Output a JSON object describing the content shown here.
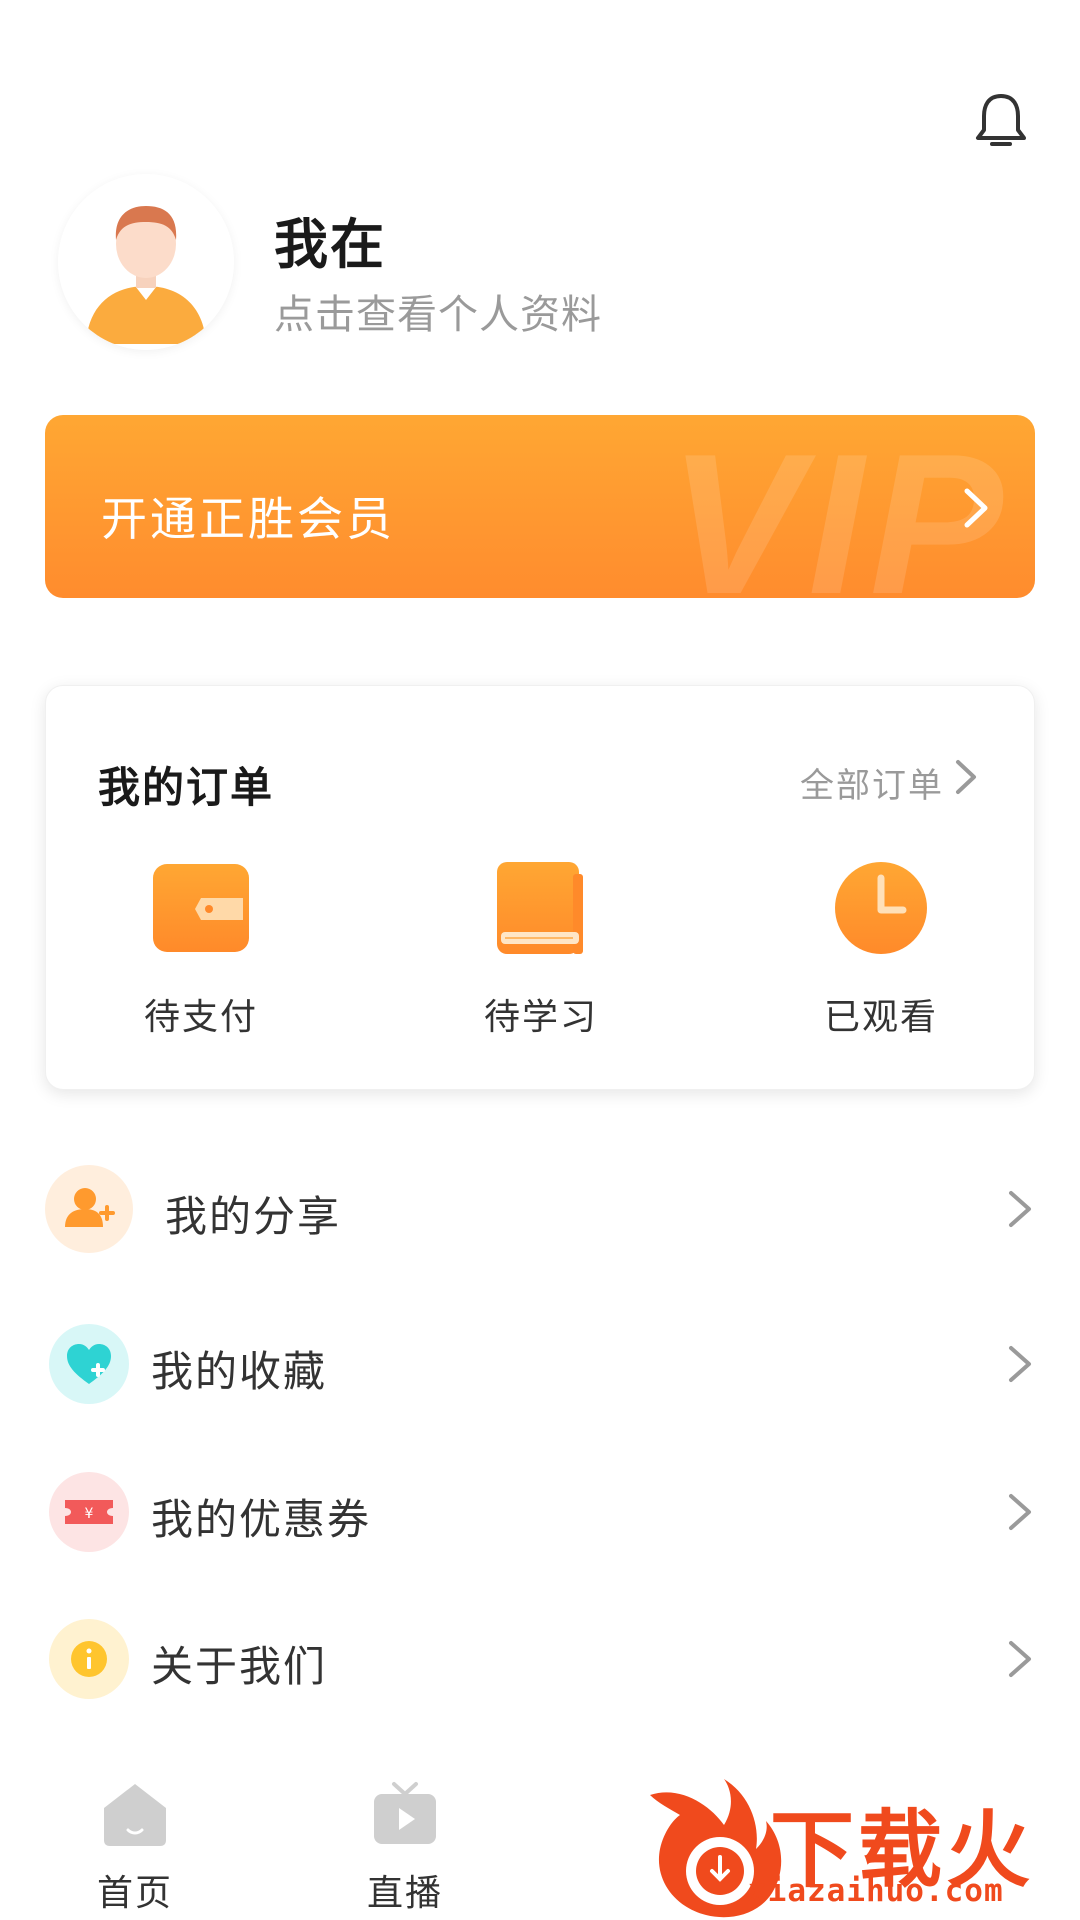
{
  "header": {
    "notification_icon": "bell-icon"
  },
  "profile": {
    "avatar_icon": "user-avatar",
    "username": "我在",
    "subtitle": "点击查看个人资料"
  },
  "vip_banner": {
    "label": "开通正胜会员",
    "watermark_text": "VIP",
    "gradient_top": "#ffa733",
    "gradient_bottom": "#ff8c2e"
  },
  "orders": {
    "title": "我的订单",
    "all_label": "全部订单",
    "items": [
      {
        "label": "待支付",
        "icon": "wallet-icon"
      },
      {
        "label": "待学习",
        "icon": "book-icon"
      },
      {
        "label": "已观看",
        "icon": "clock-icon"
      }
    ]
  },
  "menu": [
    {
      "label": "我的分享",
      "icon": "share-user-icon",
      "color": "#ff9a2e"
    },
    {
      "label": "我的收藏",
      "icon": "favorite-heart-icon",
      "color": "#2ed3d3"
    },
    {
      "label": "我的优惠券",
      "icon": "coupon-icon",
      "color": "#f25a5a"
    },
    {
      "label": "关于我们",
      "icon": "info-icon",
      "color": "#ffc52e"
    }
  ],
  "tabbar": {
    "tabs": [
      {
        "label": "首页",
        "icon": "home-icon"
      },
      {
        "label": "直播",
        "icon": "live-tv-icon"
      }
    ]
  },
  "watermark": {
    "brand_cn": "下载火",
    "brand_url": "xiazaihuo.com",
    "color": "#f04a1d"
  },
  "theme": {
    "accent": "#ff9a2e",
    "text_secondary": "#9a9a9a"
  }
}
